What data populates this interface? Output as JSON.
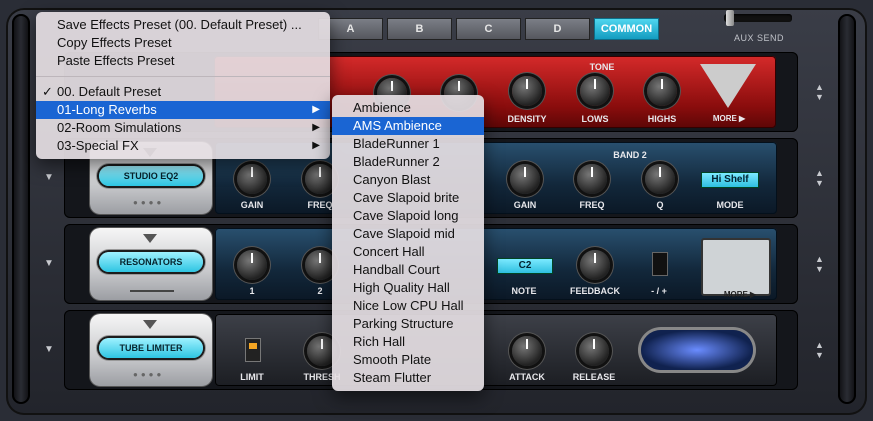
{
  "top_tabs": [
    "A",
    "B",
    "C",
    "D",
    "COMMON"
  ],
  "top_tabs_selected": "COMMON",
  "aux_send_label": "AUX SEND",
  "modules": {
    "reverb": {
      "section_label": "TONE",
      "knobs": [
        "DENSITY",
        "LOWS",
        "HIGHS"
      ],
      "more": "MORE ▶"
    },
    "eq": {
      "name": "STUDIO EQ2",
      "band_label": "BAND 2",
      "knobs_left": [
        "GAIN",
        "FREQ"
      ],
      "knobs_right": [
        "GAIN",
        "FREQ",
        "Q",
        "MODE"
      ],
      "lcd_value": "Hi Shelf"
    },
    "resonators": {
      "name": "RESONATORS",
      "left_labels": [
        "1",
        "2"
      ],
      "note_label": "NOTE",
      "note_value": "C2",
      "feedback_label": "FEEDBACK",
      "switch_label": "- / +",
      "more": "MORE ▶"
    },
    "limiter": {
      "name": "TUBE LIMITER",
      "knobs": [
        "LIMIT",
        "THRESH",
        "ATTACK",
        "RELEASE"
      ]
    }
  },
  "main_menu": {
    "items_top": [
      "Save Effects Preset (00. Default Preset) ...",
      "Copy Effects Preset",
      "Paste Effects Preset"
    ],
    "items_presets": [
      {
        "label": "00. Default Preset",
        "checked": true,
        "submenu": false
      },
      {
        "label": "01-Long Reverbs",
        "checked": false,
        "submenu": true,
        "highlighted": true
      },
      {
        "label": "02-Room Simulations",
        "checked": false,
        "submenu": true
      },
      {
        "label": "03-Special FX",
        "checked": false,
        "submenu": true
      }
    ],
    "check_glyph": "✓",
    "submenu_glyph": "▶"
  },
  "submenu": {
    "highlighted": "AMS Ambience",
    "items": [
      "Ambience",
      "AMS Ambience",
      "BladeRunner 1",
      "BladeRunner 2",
      "Canyon Blast",
      "Cave Slapoid brite",
      "Cave Slapoid long",
      "Cave Slapoid mid",
      "Concert Hall",
      "Handball Court",
      "High Quality Hall",
      "Nice Low CPU Hall",
      "Parking Structure",
      "Rich Hall",
      "Smooth Plate",
      "Steam Flutter"
    ]
  }
}
